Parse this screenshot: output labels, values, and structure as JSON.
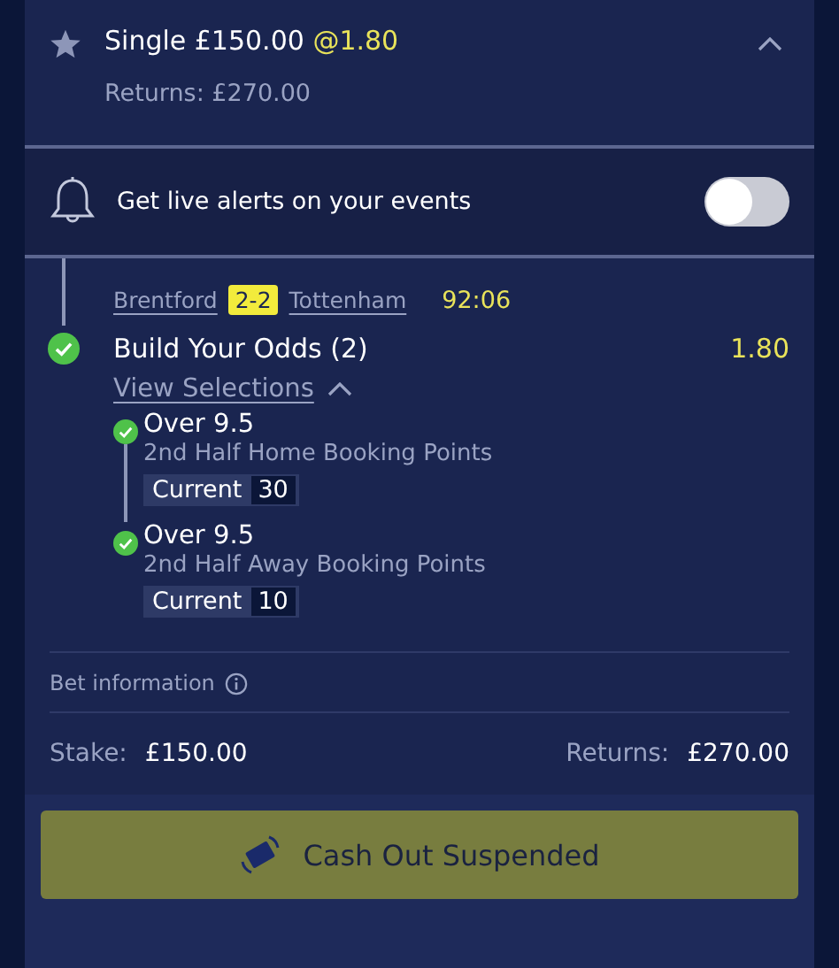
{
  "bet": {
    "title": "Single £150.00",
    "odds": "@1.80",
    "returns": "Returns: £270.00",
    "expanded": true
  },
  "alerts": {
    "label": "Get live alerts on your events",
    "on": false
  },
  "match": {
    "home": "Brentford",
    "score": "2-2",
    "away": "Tottenham",
    "clock": "92:06"
  },
  "selection": {
    "name": "Build Your Odds (2)",
    "odds": "1.80",
    "won": true,
    "link": "View Selections",
    "expanded": true
  },
  "legs": [
    {
      "title": "Over 9.5",
      "market": "2nd Half Home Booking Points",
      "current_label": "Current",
      "current": "30",
      "won": true
    },
    {
      "title": "Over 9.5",
      "market": "2nd Half Away Booking Points",
      "current_label": "Current",
      "current": "10",
      "won": true
    }
  ],
  "bet_info": "Bet information",
  "stake": {
    "label": "Stake:",
    "value": "£150.00"
  },
  "returns": {
    "label": "Returns:",
    "value": "£270.00"
  },
  "cash_out": {
    "label": "Cash Out Suspended",
    "disabled": true
  }
}
